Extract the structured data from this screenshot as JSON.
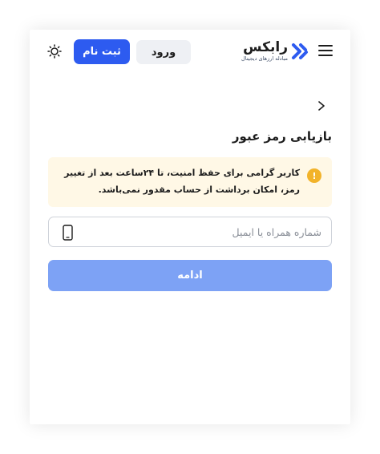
{
  "header": {
    "logo_word": "رابکس",
    "logo_tagline": "مبادله ارزهای دیجیتال",
    "login_label": "ورود",
    "signup_label": "ثبت نام"
  },
  "page": {
    "title": "بازیابی رمز عبور"
  },
  "alert": {
    "icon_symbol": "!",
    "message": "کاربر گرامی برای حفظ امنیت، تا ۲۴ساعت بعد از تغییر رمز، امکان برداشت از حساب مقدور نمی‌باشد."
  },
  "form": {
    "identifier_placeholder": "شماره همراه یا ایمیل",
    "identifier_value": "",
    "continue_label": "ادامه"
  },
  "colors": {
    "brand_blue": "#2d5bf0",
    "continue_disabled": "#7da2f5",
    "alert_background": "#fff8e6",
    "alert_icon": "#f2b32a"
  },
  "icons": {
    "menu": "hamburger-menu-icon",
    "logo": "rabex-logo-icon",
    "theme": "sun-icon",
    "back": "chevron-right-icon",
    "alert": "warning-icon",
    "input": "mobile-phone-icon"
  }
}
